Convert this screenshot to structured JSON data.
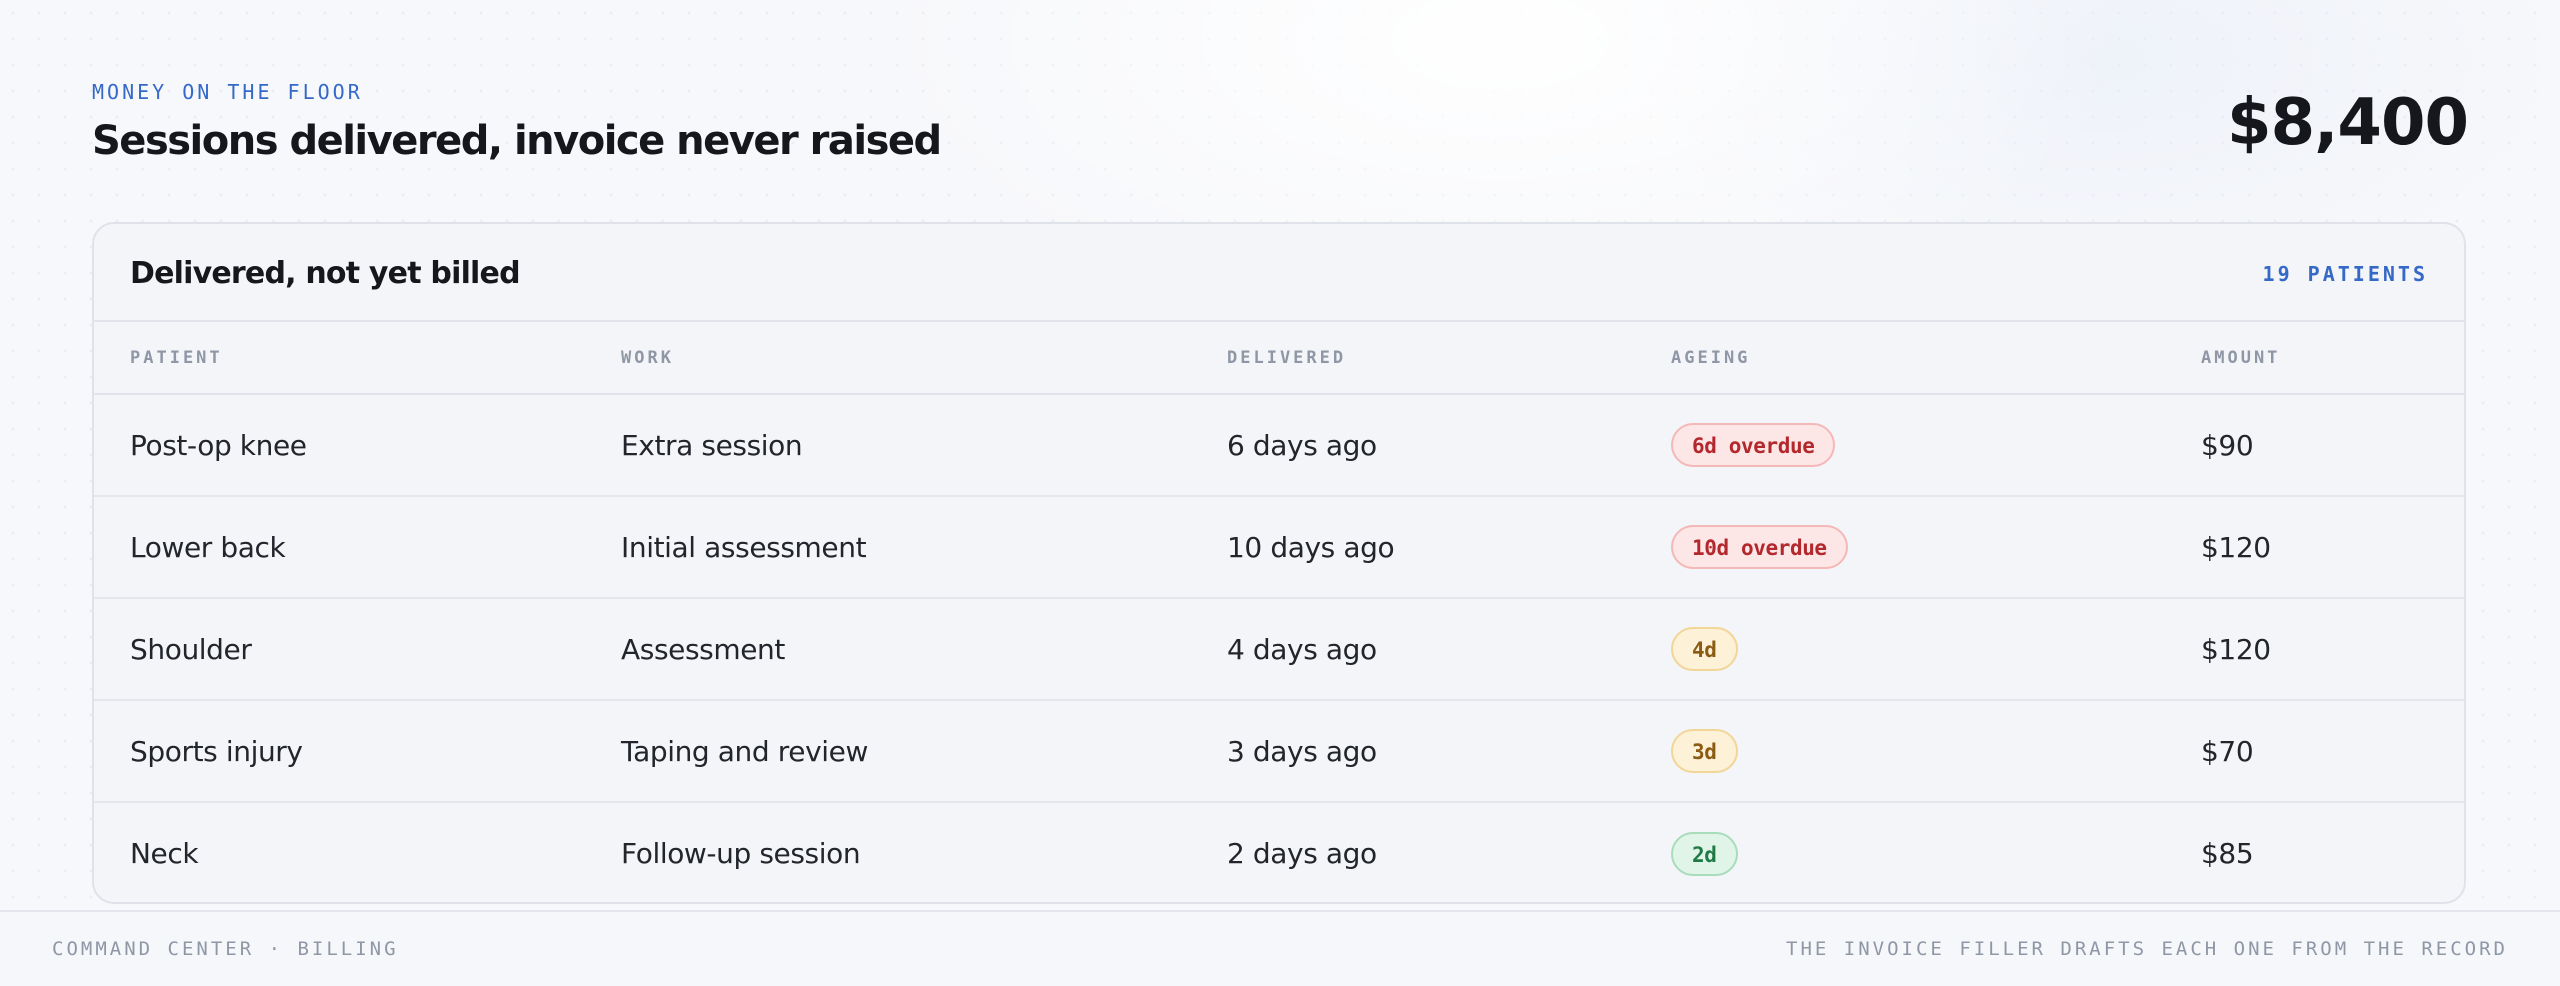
{
  "header": {
    "eyebrow": "MONEY ON THE FLOOR",
    "title": "Sessions delivered, invoice never raised",
    "total": "$8,400"
  },
  "card": {
    "title": "Delivered, not yet billed",
    "count": "19 PATIENTS",
    "columns": [
      "PATIENT",
      "WORK",
      "DELIVERED",
      "AGEING",
      "AMOUNT"
    ],
    "rows": [
      {
        "patient": "Post-op knee",
        "work": "Extra session",
        "delivered": "6 days ago",
        "ageing": "6d overdue",
        "status": "overdue",
        "amount": "$90"
      },
      {
        "patient": "Lower back",
        "work": "Initial assessment",
        "delivered": "10 days ago",
        "ageing": "10d overdue",
        "status": "overdue",
        "amount": "$120"
      },
      {
        "patient": "Shoulder",
        "work": "Assessment",
        "delivered": "4 days ago",
        "ageing": "4d",
        "status": "warning",
        "amount": "$120"
      },
      {
        "patient": "Sports injury",
        "work": "Taping and review",
        "delivered": "3 days ago",
        "ageing": "3d",
        "status": "warning",
        "amount": "$70"
      },
      {
        "patient": "Neck",
        "work": "Follow-up session",
        "delivered": "2 days ago",
        "ageing": "2d",
        "status": "ok",
        "amount": "$85"
      }
    ]
  },
  "footer": {
    "left": "COMMAND CENTER · BILLING",
    "right": "THE INVOICE FILLER DRAFTS EACH ONE FROM THE RECORD"
  },
  "colors": {
    "accent": "#3569c8",
    "overdue": "#b3282d",
    "warning": "#8a5b12",
    "ok": "#1f7a45"
  }
}
